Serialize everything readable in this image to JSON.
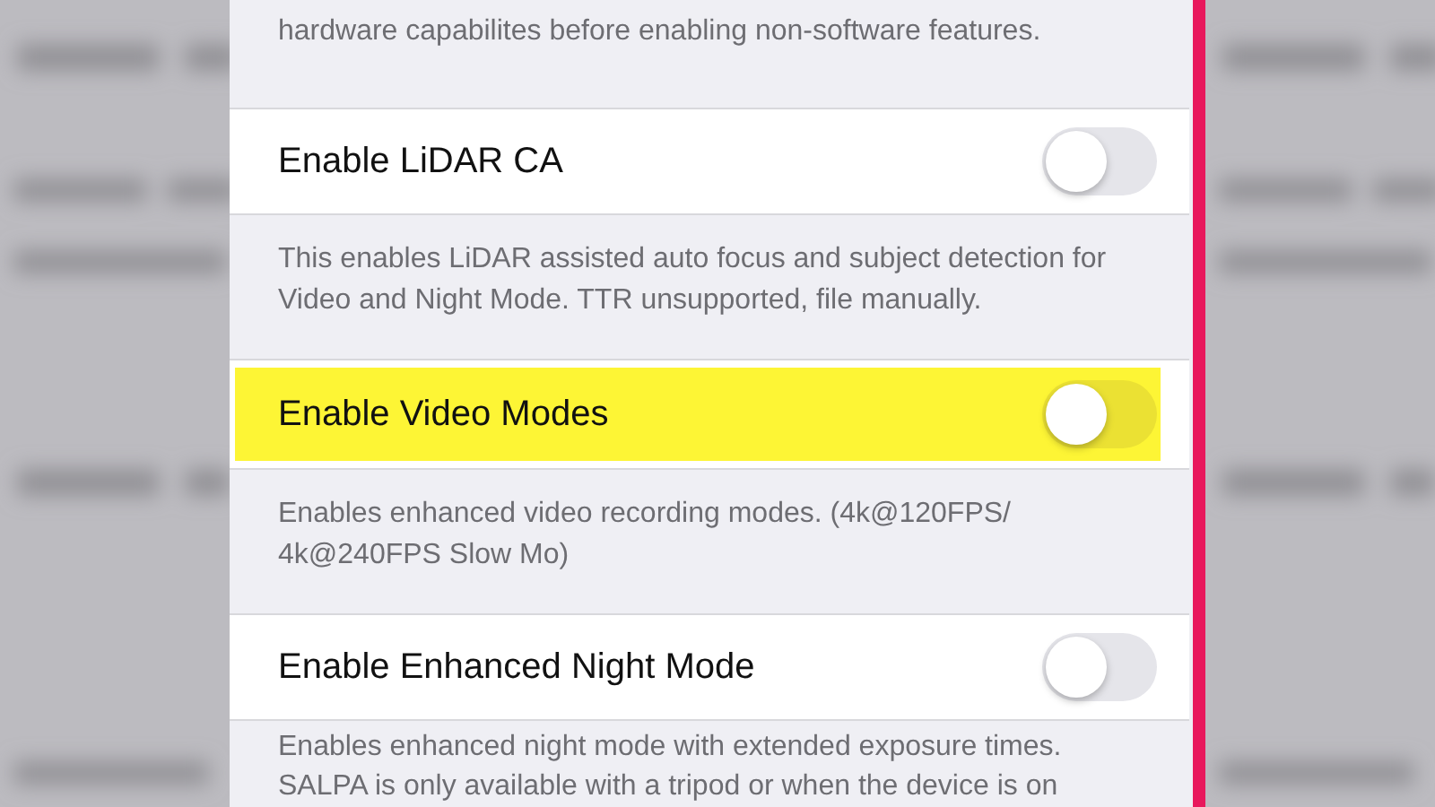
{
  "items": [
    {
      "kind": "footer",
      "text": "hardware capabilites before enabling non-software features."
    },
    {
      "kind": "toggle",
      "label": "Enable LiDAR CA",
      "on": false,
      "highlighted": false
    },
    {
      "kind": "footer",
      "text": "This enables LiDAR assisted auto focus and subject detection for Video and Night Mode. TTR unsupported, file manually."
    },
    {
      "kind": "toggle",
      "label": "Enable Video Modes",
      "on": false,
      "highlighted": true
    },
    {
      "kind": "footer",
      "text": "Enables enhanced video recording modes. (4k@120FPS/ 4k@240FPS Slow Mo)"
    },
    {
      "kind": "toggle",
      "label": "Enable Enhanced Night Mode",
      "on": false,
      "highlighted": false
    },
    {
      "kind": "footer",
      "text": "Enables enhanced night mode with extended exposure times. SALPA is only available with a tripod or when the device is on"
    }
  ]
}
